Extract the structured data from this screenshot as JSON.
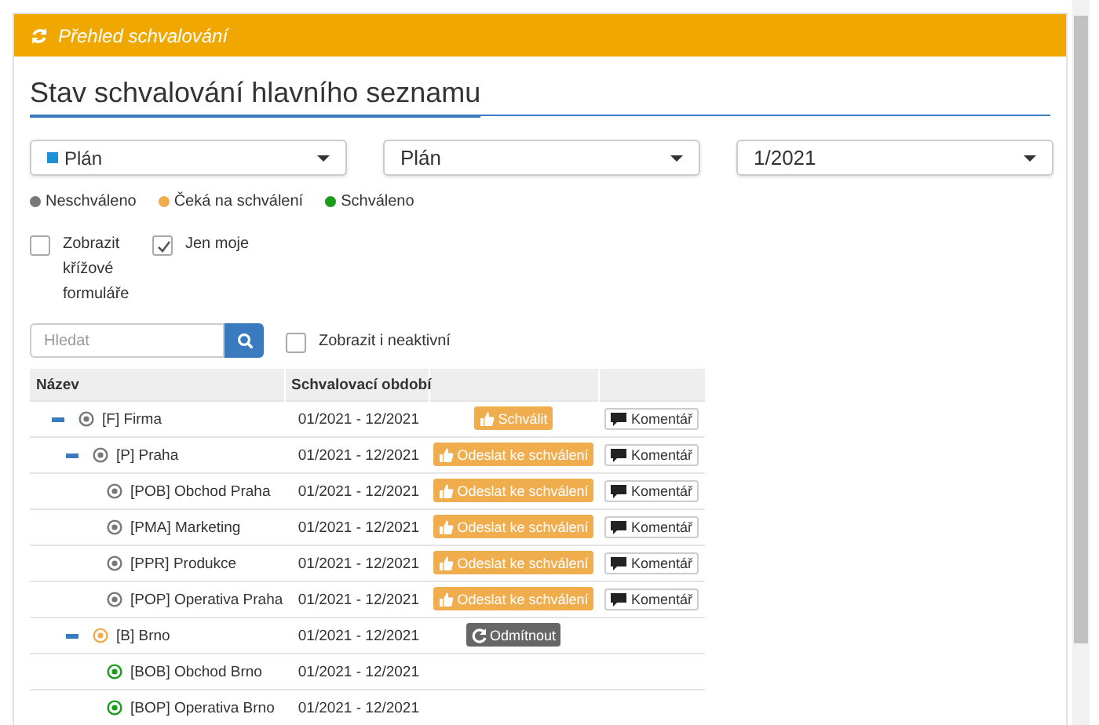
{
  "panel": {
    "title": "Přehled schvalování"
  },
  "heading": "Stav schvalování hlavního seznamu",
  "filters": [
    {
      "kind": "color",
      "value": "Plán",
      "color": "#1e90d6"
    },
    {
      "kind": "plain",
      "value": "Plán"
    },
    {
      "kind": "plain",
      "value": "1/2021"
    }
  ],
  "legend": [
    {
      "label": "Neschváleno",
      "color": "#777777"
    },
    {
      "label": "Čeká na schválení",
      "color": "#f0ad4e"
    },
    {
      "label": "Schváleno",
      "color": "#1a9c1a"
    }
  ],
  "options": [
    {
      "label": "Zobrazit křížové formuláře",
      "checked": false
    },
    {
      "label": "Jen moje",
      "checked": true
    }
  ],
  "search": {
    "placeholder": "Hledat"
  },
  "show_inactive": {
    "label": "Zobrazit i neaktivní",
    "checked": false
  },
  "table": {
    "columns": [
      "Název",
      "Schvalovací období"
    ],
    "rows": [
      {
        "name": "[F] Firma",
        "period": "01/2021 - 12/2021",
        "color": "#777777",
        "expanded": true,
        "action": {
          "kind": "approve",
          "label": "Schválit"
        },
        "comment": "Komentář",
        "children": [
          {
            "name": "[P] Praha",
            "period": "01/2021 - 12/2021",
            "color": "#777777",
            "expanded": true,
            "action": {
              "kind": "send",
              "label": "Odeslat ke schválení"
            },
            "comment": "Komentář",
            "children": [
              {
                "name": "[POB] Obchod Praha",
                "period": "01/2021 - 12/2021",
                "color": "#777777",
                "action": {
                  "kind": "send",
                  "label": "Odeslat ke schválení"
                },
                "comment": "Komentář"
              },
              {
                "name": "[PMA] Marketing",
                "period": "01/2021 - 12/2021",
                "color": "#777777",
                "action": {
                  "kind": "send",
                  "label": "Odeslat ke schválení"
                },
                "comment": "Komentář"
              },
              {
                "name": "[PPR] Produkce",
                "period": "01/2021 - 12/2021",
                "color": "#777777",
                "action": {
                  "kind": "send",
                  "label": "Odeslat ke schválení"
                },
                "comment": "Komentář"
              },
              {
                "name": "[POP] Operativa Praha",
                "period": "01/2021 - 12/2021",
                "color": "#777777",
                "action": {
                  "kind": "send",
                  "label": "Odeslat ke schválení"
                },
                "comment": "Komentář"
              }
            ]
          },
          {
            "name": "[B] Brno",
            "period": "01/2021 - 12/2021",
            "color": "#f0ad4e",
            "expanded": true,
            "action": {
              "kind": "reject",
              "label": "Odmítnout"
            },
            "children": [
              {
                "name": "[BOB] Obchod Brno",
                "period": "01/2021 - 12/2021",
                "color": "#1a9c1a"
              },
              {
                "name": "[BOP] Operativa Brno",
                "period": "01/2021 - 12/2021",
                "color": "#1a9c1a"
              }
            ]
          }
        ]
      }
    ]
  }
}
